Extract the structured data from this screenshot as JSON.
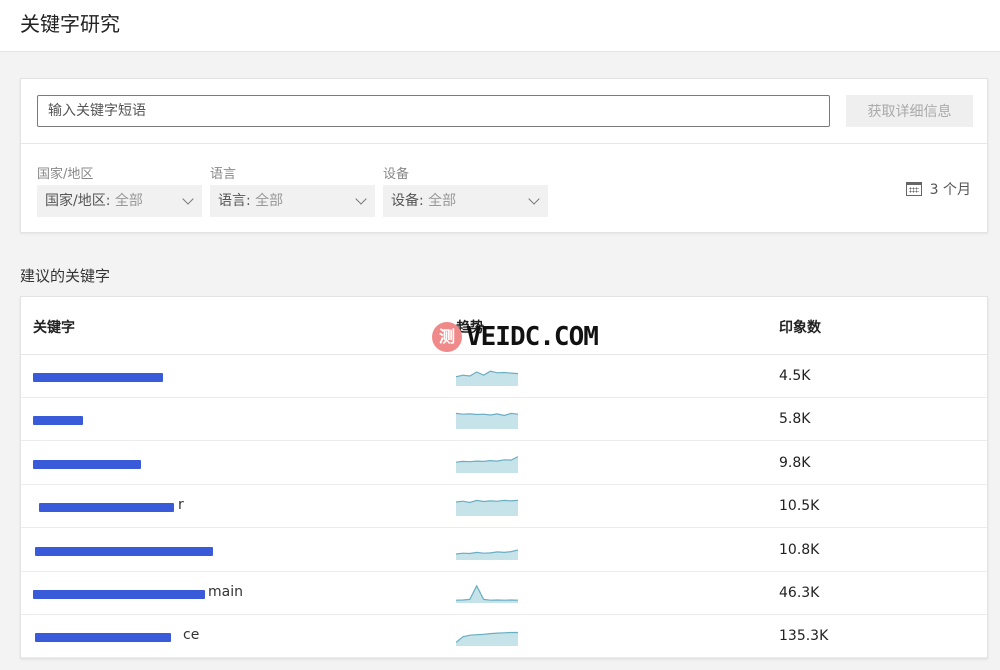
{
  "page": {
    "title": "关键字研究"
  },
  "search": {
    "placeholder": "输入关键字短语",
    "button_label": "获取详细信息"
  },
  "filters": [
    {
      "label": "国家/地区",
      "prefix": "国家/地区: ",
      "value": "全部"
    },
    {
      "label": "语言",
      "prefix": "语言: ",
      "value": "全部"
    },
    {
      "label": "设备",
      "prefix": "设备: ",
      "value": "全部"
    }
  ],
  "period": {
    "label": "3 个月",
    "icon": "calendar-icon"
  },
  "suggestions": {
    "title": "建议的关键字",
    "columns": [
      "关键字",
      "趋势",
      "印象数"
    ],
    "rows": [
      {
        "keyword": "",
        "impressions": "4.5K",
        "trend": [
          0.45,
          0.55,
          0.5,
          0.75,
          0.55,
          0.8,
          0.7,
          0.72,
          0.68,
          0.65
        ]
      },
      {
        "keyword": "",
        "impressions": "5.8K",
        "trend": [
          0.85,
          0.8,
          0.82,
          0.78,
          0.8,
          0.75,
          0.82,
          0.72,
          0.85,
          0.8
        ]
      },
      {
        "keyword": "",
        "impressions": "9.8K",
        "trend": [
          0.55,
          0.6,
          0.58,
          0.62,
          0.6,
          0.65,
          0.62,
          0.7,
          0.68,
          0.9
        ]
      },
      {
        "keyword": "r",
        "impressions": "10.5K",
        "trend": [
          0.75,
          0.8,
          0.72,
          0.85,
          0.78,
          0.82,
          0.8,
          0.85,
          0.82,
          0.85
        ]
      },
      {
        "keyword": "",
        "impressions": "10.8K",
        "trend": [
          0.25,
          0.3,
          0.28,
          0.35,
          0.3,
          0.32,
          0.38,
          0.35,
          0.4,
          0.5
        ]
      },
      {
        "keyword": "main",
        "impressions": "46.3K",
        "trend": [
          0.05,
          0.06,
          0.1,
          0.95,
          0.1,
          0.05,
          0.06,
          0.05,
          0.06,
          0.05
        ]
      },
      {
        "keyword": "ce",
        "impressions": "135.3K",
        "trend": [
          0.1,
          0.45,
          0.55,
          0.58,
          0.6,
          0.65,
          0.68,
          0.7,
          0.72,
          0.72
        ]
      }
    ]
  },
  "watermark": {
    "badge": "测",
    "text": "VEIDC.COM"
  },
  "colors": {
    "redaction": "#3a5bd9",
    "spark_fill": "#c7e3ea",
    "spark_line": "#6aaec2"
  }
}
